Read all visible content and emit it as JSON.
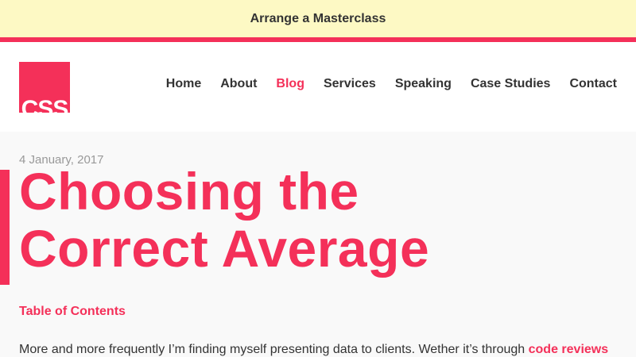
{
  "banner": {
    "link": "Arrange a Masterclass"
  },
  "header": {
    "logo_text": "CSS",
    "nav": [
      {
        "label": "Home"
      },
      {
        "label": "About"
      },
      {
        "label": "Blog"
      },
      {
        "label": "Services"
      },
      {
        "label": "Speaking"
      },
      {
        "label": "Case Studies"
      },
      {
        "label": "Contact"
      }
    ],
    "active_nav": "Blog"
  },
  "article": {
    "date": "4 January, 2017",
    "title_line1": "Choosing the",
    "title_line2": "Correct Average",
    "toc_label": "Table of Contents",
    "intro_text": "More and more frequently I’m finding myself presenting data to clients. Wether it’s through ",
    "intro_link": "code reviews"
  },
  "colors": {
    "accent": "#f43059",
    "banner_bg": "#fdf9c4",
    "text": "#333333",
    "muted": "#999999"
  }
}
